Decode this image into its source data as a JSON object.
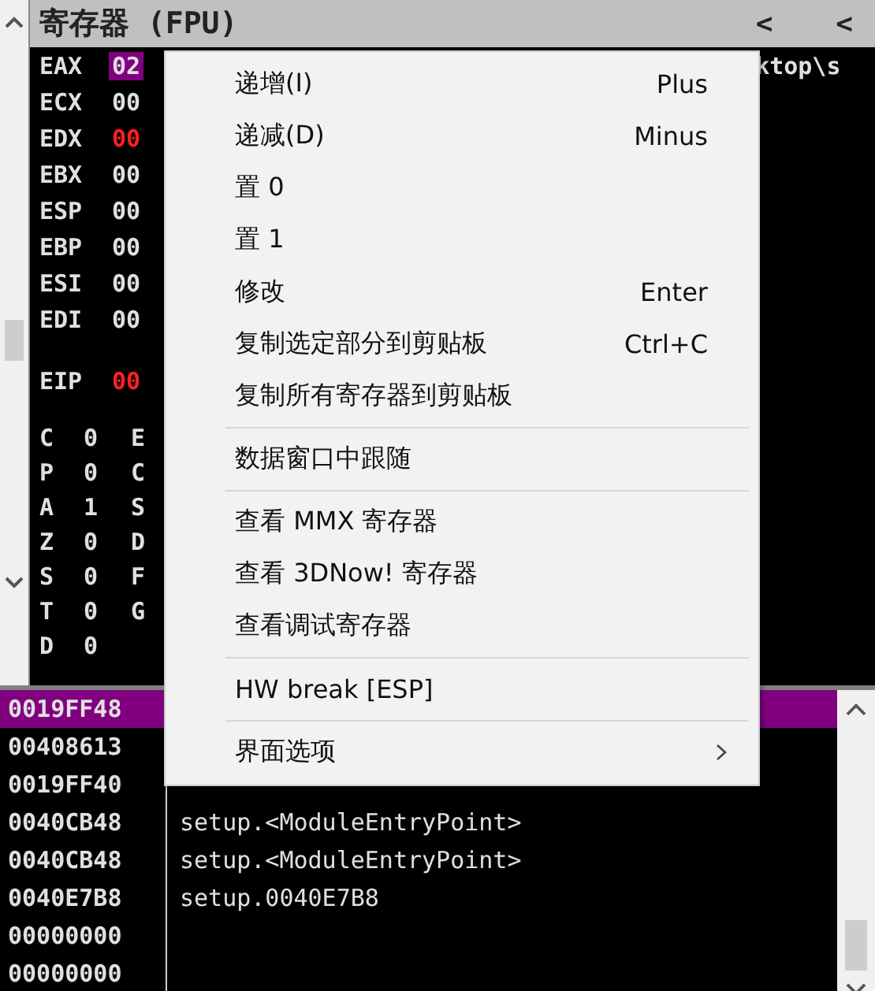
{
  "registers_panel": {
    "title": "寄存器 (FPU)",
    "header_buttons": [
      "<",
      "<"
    ]
  },
  "registers": [
    {
      "name": "EAX",
      "value": "02",
      "highlighted": true,
      "changed": false,
      "note": "ktop\\s"
    },
    {
      "name": "ECX",
      "value": "00",
      "highlighted": false,
      "changed": false
    },
    {
      "name": "EDX",
      "value": "00",
      "highlighted": false,
      "changed": true
    },
    {
      "name": "EBX",
      "value": "00",
      "highlighted": false,
      "changed": false
    },
    {
      "name": "ESP",
      "value": "00",
      "highlighted": false,
      "changed": false
    },
    {
      "name": "EBP",
      "value": "00",
      "highlighted": false,
      "changed": false
    },
    {
      "name": "ESI",
      "value": "00",
      "highlighted": false,
      "changed": false
    },
    {
      "name": "EDI",
      "value": "00",
      "highlighted": false,
      "changed": false
    }
  ],
  "instruction_pointer": {
    "name": "EIP",
    "value": "00",
    "changed": true
  },
  "flags": [
    {
      "name": "C",
      "value": "0",
      "extra": "E"
    },
    {
      "name": "P",
      "value": "0",
      "extra": "C"
    },
    {
      "name": "A",
      "value": "1",
      "extra": "S"
    },
    {
      "name": "Z",
      "value": "0",
      "extra": "D"
    },
    {
      "name": "S",
      "value": "0",
      "extra": "F"
    },
    {
      "name": "T",
      "value": "0",
      "extra": "G"
    },
    {
      "name": "D",
      "value": "0"
    }
  ],
  "stack": [
    {
      "address": "0019FF48",
      "selected": true
    },
    {
      "address": "00408613",
      "selected": false
    },
    {
      "address": "0019FF40",
      "selected": false
    },
    {
      "address": "0040CB48",
      "comment": "setup.<ModuleEntryPoint>",
      "selected": false
    },
    {
      "address": "0040CB48",
      "comment": "setup.<ModuleEntryPoint>",
      "selected": false
    },
    {
      "address": "0040E7B8",
      "comment": "setup.0040E7B8",
      "selected": false
    },
    {
      "address": "00000000",
      "selected": false
    },
    {
      "address": "00000000",
      "selected": false
    }
  ],
  "context_menu": [
    {
      "kind": "item",
      "label": "递增(I)",
      "shortcut": "Plus"
    },
    {
      "kind": "item",
      "label": "递减(D)",
      "shortcut": "Minus"
    },
    {
      "kind": "item",
      "label": "置 0"
    },
    {
      "kind": "item",
      "label": "置 1"
    },
    {
      "kind": "item",
      "label": "修改",
      "shortcut": "Enter"
    },
    {
      "kind": "item",
      "label": "复制选定部分到剪贴板",
      "shortcut": "Ctrl+C"
    },
    {
      "kind": "item",
      "label": "复制所有寄存器到剪贴板"
    },
    {
      "kind": "separator"
    },
    {
      "kind": "item",
      "label": "数据窗口中跟随"
    },
    {
      "kind": "separator"
    },
    {
      "kind": "item",
      "label": "查看 MMX 寄存器"
    },
    {
      "kind": "item",
      "label": "查看 3DNow! 寄存器"
    },
    {
      "kind": "item",
      "label": "查看调试寄存器"
    },
    {
      "kind": "separator"
    },
    {
      "kind": "item",
      "label": "HW break [ESP]"
    },
    {
      "kind": "separator"
    },
    {
      "kind": "submenu",
      "label": "界面选项"
    }
  ]
}
